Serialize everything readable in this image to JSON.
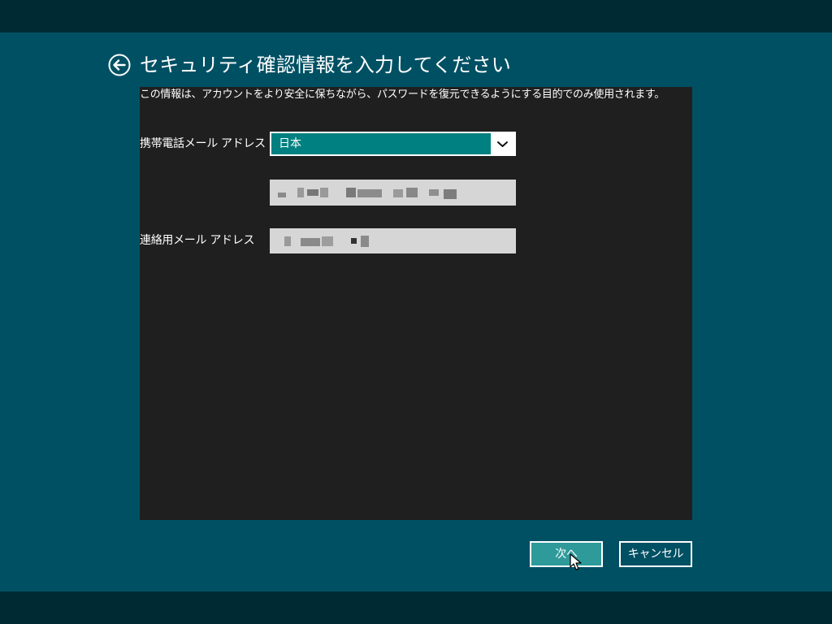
{
  "header": {
    "title": "セキュリティ確認情報を入力してください",
    "back_icon": "back-arrow-icon"
  },
  "content": {
    "description": "この情報は、アカウントをより安全に保ちながら、パスワードを復元できるようにする目的でのみ使用されます。",
    "phone_email": {
      "label": "携帯電話メール アドレス",
      "country_selected": "日本"
    },
    "contact_email": {
      "label": "連絡用メール アドレス"
    }
  },
  "buttons": {
    "next_label": "次へ",
    "cancel_label": "キャンセル"
  },
  "colors": {
    "background": "#005064",
    "band": "#002a33",
    "panel": "#1f1f1f",
    "accent": "#008080",
    "button_primary": "#2f9a9a",
    "field": "#d6d6d6"
  }
}
